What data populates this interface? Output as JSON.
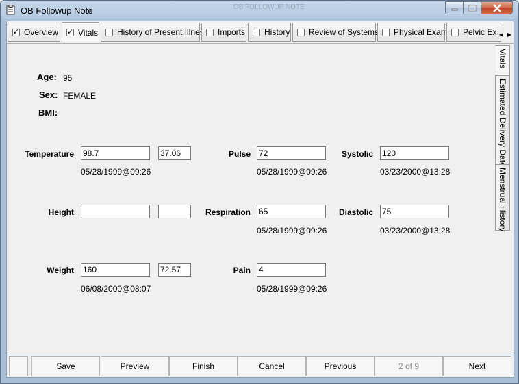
{
  "window": {
    "title": "OB Followup Note",
    "ghost_text": "OB FOLLOWUP NOTE"
  },
  "tabs": [
    {
      "label": "Overview",
      "checked": true
    },
    {
      "label": "Vitals",
      "checked": true
    },
    {
      "label": "History of Present Illness",
      "checked": false
    },
    {
      "label": "Imports",
      "checked": false
    },
    {
      "label": "History",
      "checked": false
    },
    {
      "label": "Review of Systems",
      "checked": false
    },
    {
      "label": "Physical Exam",
      "checked": false
    },
    {
      "label": "Pelvic Ex",
      "checked": false
    }
  ],
  "side_tabs": [
    "Vitals",
    "Estimated Delivery Date",
    "Menstrual History"
  ],
  "patient": {
    "age_label": "Age:",
    "age": "95",
    "sex_label": "Sex:",
    "sex": "FEMALE",
    "bmi_label": "BMI:",
    "bmi": ""
  },
  "vitals": {
    "temperature": {
      "label": "Temperature",
      "value": "98.7",
      "alt": "37.06",
      "timestamp": "05/28/1999@09:26"
    },
    "pulse": {
      "label": "Pulse",
      "value": "72",
      "timestamp": "05/28/1999@09:26"
    },
    "systolic": {
      "label": "Systolic",
      "value": "120",
      "timestamp": "03/23/2000@13:28"
    },
    "height": {
      "label": "Height",
      "value": "",
      "alt": "",
      "timestamp": ""
    },
    "respiration": {
      "label": "Respiration",
      "value": "65",
      "timestamp": "05/28/1999@09:26"
    },
    "diastolic": {
      "label": "Diastolic",
      "value": "75",
      "timestamp": "03/23/2000@13:28"
    },
    "weight": {
      "label": "Weight",
      "value": "160",
      "alt": "72.57",
      "timestamp": "06/08/2000@08:07"
    },
    "pain": {
      "label": "Pain",
      "value": "4",
      "timestamp": "05/28/1999@09:26"
    }
  },
  "footer": {
    "save": "Save",
    "preview": "Preview",
    "finish": "Finish",
    "cancel": "Cancel",
    "previous": "Previous",
    "page": "2 of 9",
    "next": "Next"
  }
}
